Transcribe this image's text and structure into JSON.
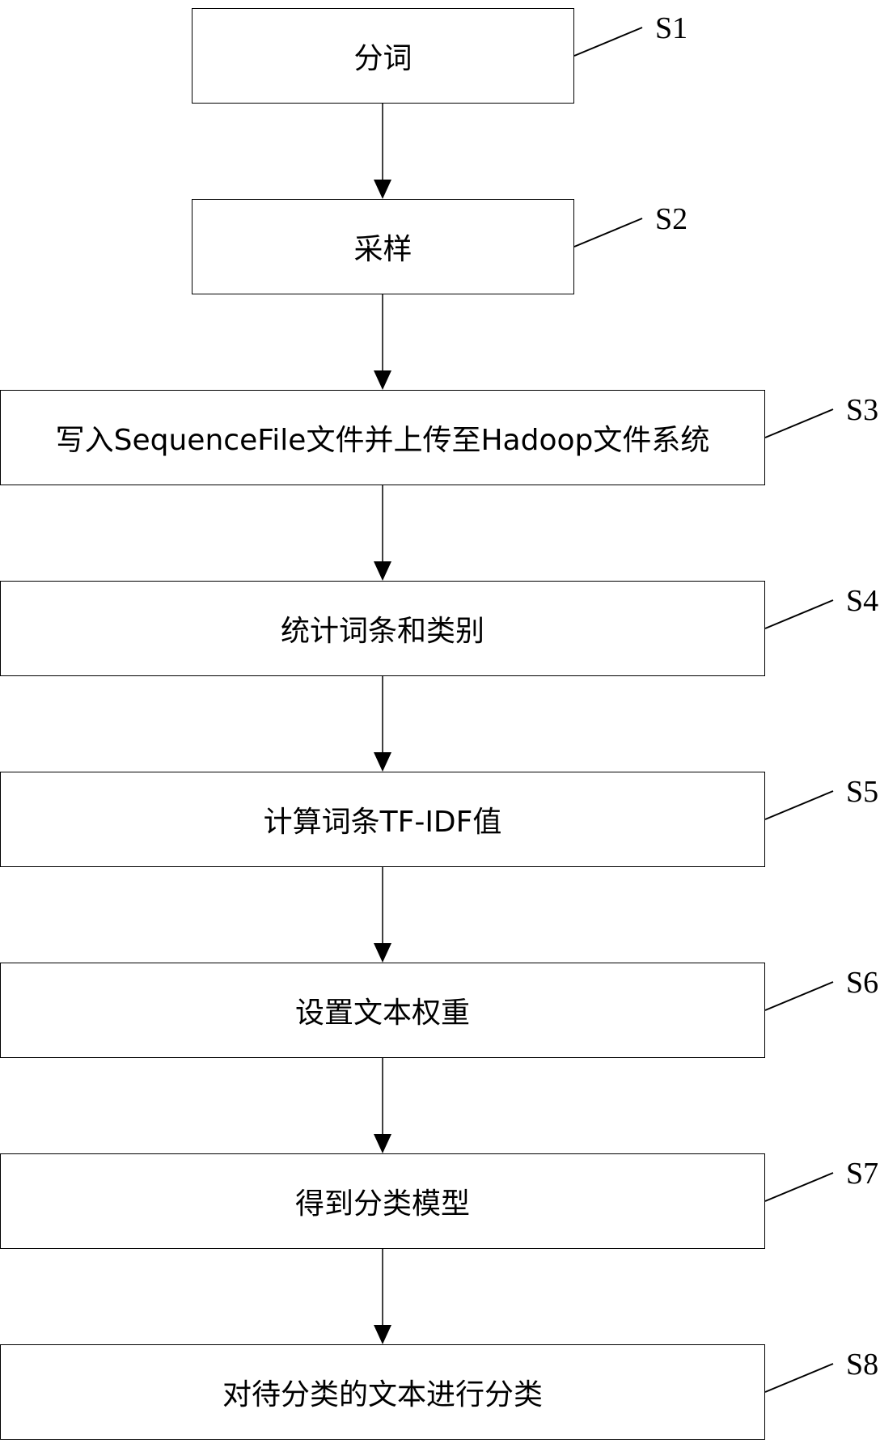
{
  "diagram": {
    "type": "flowchart",
    "direction": "top-to-bottom",
    "line_color": "#000000",
    "background": "#ffffff",
    "steps": [
      {
        "id": "S1",
        "label": "S1",
        "text": "分词"
      },
      {
        "id": "S2",
        "label": "S2",
        "text": "采样"
      },
      {
        "id": "S3",
        "label": "S3",
        "text": "写入SequenceFile文件并上传至Hadoop文件系统"
      },
      {
        "id": "S4",
        "label": "S4",
        "text": "统计词条和类别"
      },
      {
        "id": "S5",
        "label": "S5",
        "text": "计算词条TF-IDF值"
      },
      {
        "id": "S6",
        "label": "S6",
        "text": "设置文本权重"
      },
      {
        "id": "S7",
        "label": "S7",
        "text": "得到分类模型"
      },
      {
        "id": "S8",
        "label": "S8",
        "text": "对待分类的文本进行分类"
      }
    ],
    "edges": [
      {
        "from": "S1",
        "to": "S2"
      },
      {
        "from": "S2",
        "to": "S3"
      },
      {
        "from": "S3",
        "to": "S4"
      },
      {
        "from": "S4",
        "to": "S5"
      },
      {
        "from": "S5",
        "to": "S6"
      },
      {
        "from": "S6",
        "to": "S7"
      },
      {
        "from": "S7",
        "to": "S8"
      }
    ]
  }
}
